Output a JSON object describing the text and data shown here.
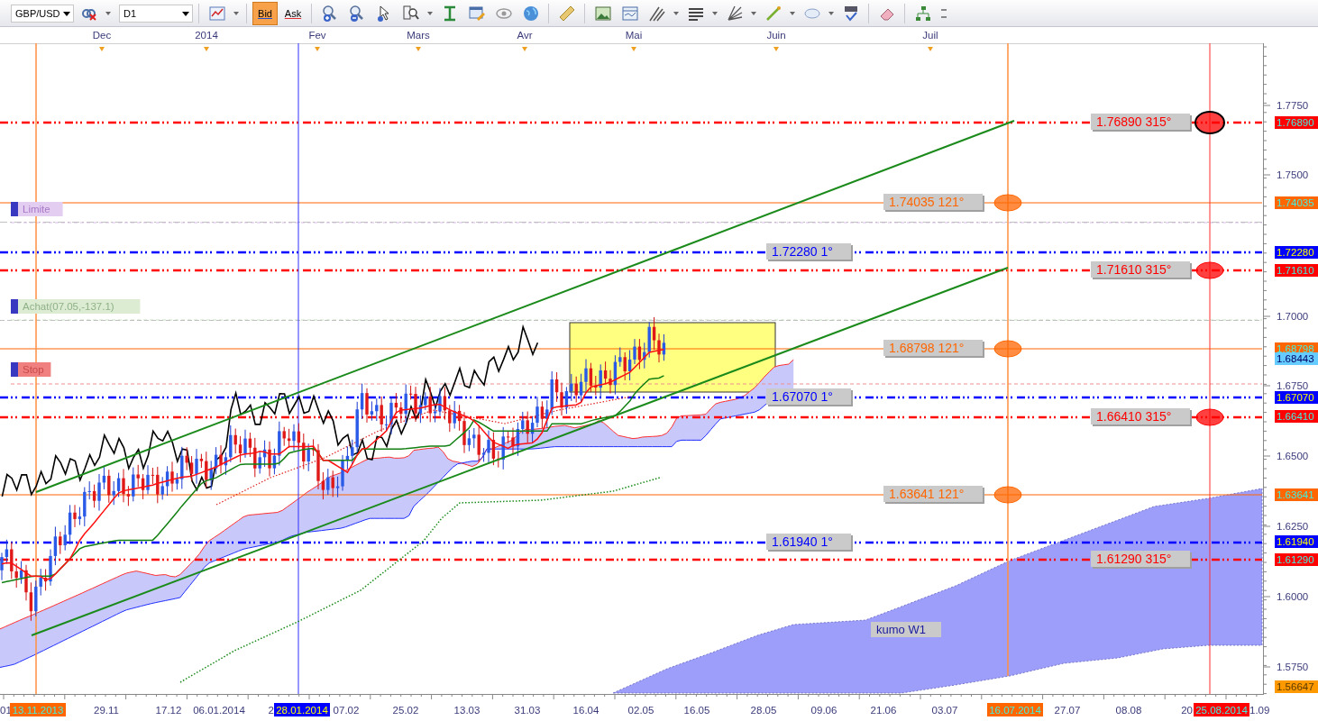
{
  "toolbar": {
    "symbol": "GBP/USD",
    "timeframe": "D1",
    "quote_buttons": [
      {
        "label": "Bid",
        "selected": true
      },
      {
        "label": "Ask",
        "selected": false
      }
    ]
  },
  "months": [
    "Dec",
    "2014",
    "Fev",
    "Mars",
    "Avr",
    "Mai",
    "Juin",
    "Juil"
  ],
  "chart": {
    "levels": [
      {
        "label": "1.76890 315°",
        "color": "#ff0000"
      },
      {
        "label": "1.74035 121°",
        "color": "#ff6600"
      },
      {
        "label": "1.72280 1°",
        "color": "#0000ff"
      },
      {
        "label": "1.71610 315°",
        "color": "#ff0000"
      },
      {
        "label": "1.68798 121°",
        "color": "#ff6600"
      },
      {
        "label": "1.67070 1°",
        "color": "#0000ff"
      },
      {
        "label": "1.66410 315°",
        "color": "#ff0000"
      },
      {
        "label": "1.63641 121°",
        "color": "#ff6600"
      },
      {
        "label": "1.61940 1°",
        "color": "#0000ff"
      },
      {
        "label": "1.61290 315°",
        "color": "#ff0000"
      }
    ],
    "orders": [
      {
        "label": "Limite",
        "kind": "limit"
      },
      {
        "label": "Achat(07.05,-137.1)",
        "kind": "buy"
      },
      {
        "label": "Stop",
        "kind": "stop"
      }
    ],
    "annotation": "kumo W1"
  },
  "price_axis": {
    "ticks": [
      "1.7750",
      "1.7500",
      "1.7000",
      "1.6750",
      "1.6500",
      "1.6250",
      "1.6000",
      "1.5750"
    ],
    "tags": [
      {
        "text": "1.76890",
        "color": "#ff0000"
      },
      {
        "text": "1.74035",
        "color": "#ff6600"
      },
      {
        "text": "1.72280",
        "color": "#0000ff"
      },
      {
        "text": "1.71610",
        "color": "#ff0000"
      },
      {
        "text": "1.68798",
        "color": "#ff6600"
      },
      {
        "text": "1.68443",
        "color": "#66ccff"
      },
      {
        "text": "1.67070",
        "color": "#0000ff"
      },
      {
        "text": "1.66410",
        "color": "#ff0000"
      },
      {
        "text": "1.63641",
        "color": "#ff6600"
      },
      {
        "text": "1.61940",
        "color": "#0000ff"
      },
      {
        "text": "1.61290",
        "color": "#ff0000"
      },
      {
        "text": "1.56647",
        "color": "#ff9900"
      }
    ]
  },
  "time_axis": {
    "dates": [
      {
        "text": "01"
      },
      {
        "text": "13.11.2013",
        "color": "#ff6600"
      },
      {
        "text": "29.11"
      },
      {
        "text": "17.12"
      },
      {
        "text": "06.01.2014"
      },
      {
        "text": "2"
      },
      {
        "text": "28.01.2014",
        "color": "#0000ff"
      },
      {
        "text": "07.02"
      },
      {
        "text": "25.02"
      },
      {
        "text": "13.03"
      },
      {
        "text": "31.03"
      },
      {
        "text": "16.04"
      },
      {
        "text": "02.05"
      },
      {
        "text": "16.05"
      },
      {
        "text": "28.05"
      },
      {
        "text": "09.06"
      },
      {
        "text": "21.06"
      },
      {
        "text": "03.07"
      },
      {
        "text": "16.07.2014",
        "color": "#ff6600"
      },
      {
        "text": "27.07"
      },
      {
        "text": "08.08"
      },
      {
        "text": "20"
      },
      {
        "text": "25.08.2014",
        "color": "#ff0000"
      },
      {
        "text": "1.09"
      }
    ]
  }
}
